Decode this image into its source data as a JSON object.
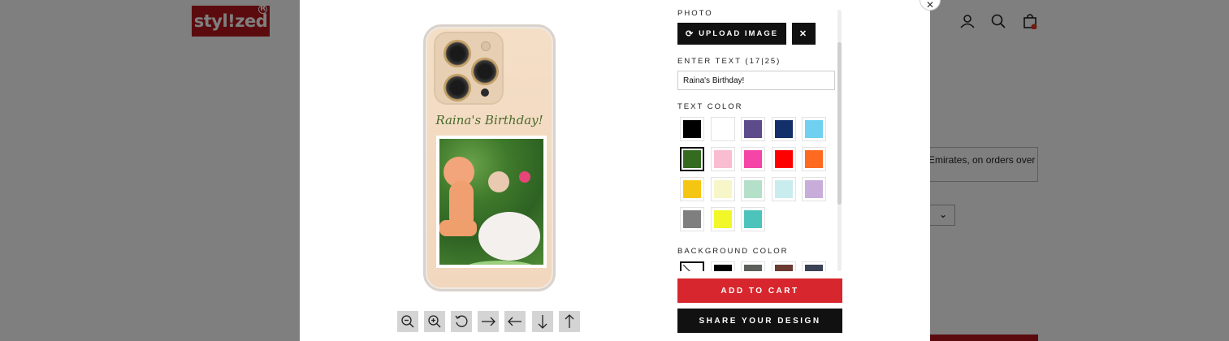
{
  "store": {
    "logo_text": "styl!zed",
    "logo_reg": "R",
    "shipping_text": "Emirates, on orders over",
    "header_icons": [
      "account-icon",
      "search-icon",
      "cart-icon"
    ]
  },
  "preview": {
    "case_text": "Raina's Birthday!",
    "tools": [
      "zoom-out-icon",
      "zoom-in-icon",
      "rotate-icon",
      "move-right-icon",
      "move-left-icon",
      "move-down-icon",
      "move-up-icon"
    ]
  },
  "panel": {
    "photo_label": "PHOTO",
    "upload_label": "UPLOAD IMAGE",
    "remove_label": "✕",
    "text_label": "ENTER TEXT (17|25)",
    "text_value": "Raina's Birthday!",
    "text_color_label": "TEXT COLOR",
    "text_colors": [
      "#000000",
      "#ffffff",
      "#5e4b8b",
      "#14306b",
      "#6fd0f0",
      "#356b1f",
      "#f9bcd0",
      "#f545a6",
      "#ff0000",
      "#ff6a21",
      "#f5c611",
      "#f6f6c8",
      "#b4dfc8",
      "#c9ecef",
      "#c8addb",
      "#7f7f7f",
      "#f2f72a",
      "#4cc4bc"
    ],
    "selected_text_color_index": 5,
    "background_color_label": "BACKGROUND COLOR",
    "background_colors": [
      "none",
      "#000000",
      "#5c5f5a",
      "#6b3b32",
      "#3b4255"
    ],
    "add_to_cart_label": "ADD TO CART",
    "share_label": "SHARE YOUR DESIGN"
  },
  "colors": {
    "brand_red": "#b7171d",
    "cart_red": "#d7262d"
  }
}
